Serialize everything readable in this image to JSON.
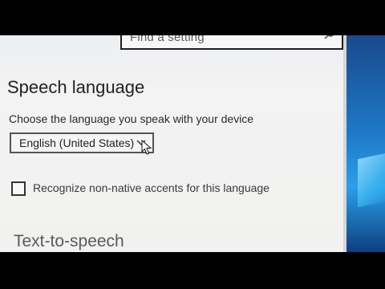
{
  "search": {
    "placeholder": "Find a setting",
    "icon": "search-icon"
  },
  "speech_language": {
    "title": "Speech language",
    "description": "Choose the language you speak with your device",
    "selected_language": "English (United States)",
    "chevron_icon": "chevron-down-icon"
  },
  "accents": {
    "label": "Recognize non-native accents for this language",
    "checked": false
  },
  "text_to_speech": {
    "title": "Text-to-speech"
  },
  "colors": {
    "window_bg": "#f1f1f0",
    "text": "#222222",
    "desktop_accent": "#1e78c8"
  }
}
